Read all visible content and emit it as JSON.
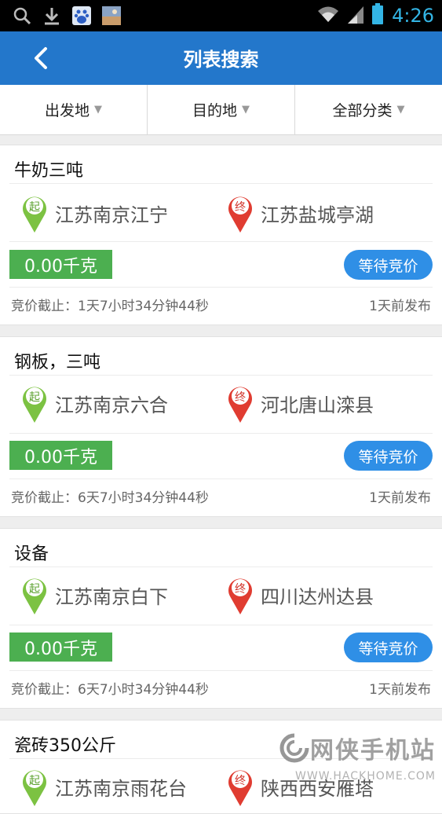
{
  "status_bar": {
    "time": "4:26"
  },
  "header": {
    "title": "列表搜索"
  },
  "filters": [
    {
      "label": "出发地"
    },
    {
      "label": "目的地"
    },
    {
      "label": "全部分类"
    }
  ],
  "listings": [
    {
      "name": "牛奶三吨",
      "origin_badge": "起",
      "origin": "江苏南京江宁",
      "dest_badge": "终",
      "destination": "江苏盐城亭湖",
      "weight": "0.00千克",
      "action": "等待竞价",
      "deadline": "竞价截止：1天7小时34分钟44秒",
      "posted": "1天前发布"
    },
    {
      "name": "钢板，三吨",
      "origin_badge": "起",
      "origin": "江苏南京六合",
      "dest_badge": "终",
      "destination": "河北唐山滦县",
      "weight": "0.00千克",
      "action": "等待竞价",
      "deadline": "竞价截止：6天7小时34分钟44秒",
      "posted": "1天前发布"
    },
    {
      "name": "设备",
      "origin_badge": "起",
      "origin": "江苏南京白下",
      "dest_badge": "终",
      "destination": "四川达州达县",
      "weight": "0.00千克",
      "action": "等待竞价",
      "deadline": "竞价截止：6天7小时34分钟44秒",
      "posted": "1天前发布"
    },
    {
      "name": "瓷砖350公斤",
      "origin_badge": "起",
      "origin": "江苏南京雨花台",
      "dest_badge": "终",
      "destination": "陕西西安雁塔"
    }
  ],
  "watermark": {
    "text": "网侠手机站",
    "sub": "WWW.HACKHOME.COM"
  },
  "colors": {
    "appbar": "#2377cb",
    "weight_bg": "#4caf50",
    "button_bg": "#2f8fe6",
    "origin_pin": "#7cc242",
    "dest_pin": "#e03c31"
  }
}
